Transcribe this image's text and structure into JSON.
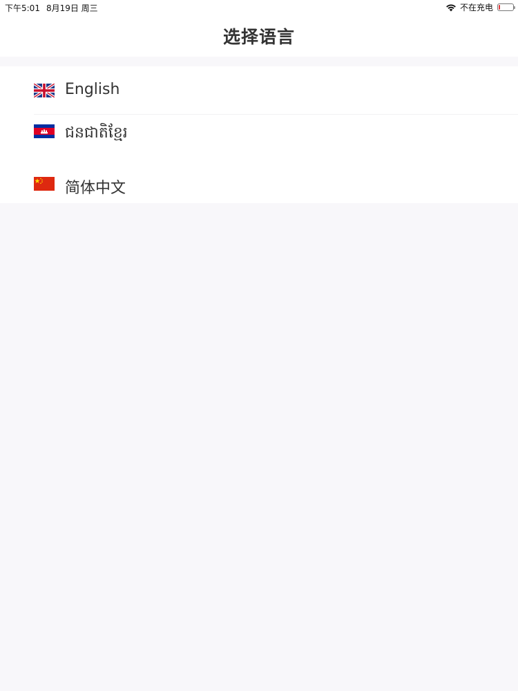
{
  "status_bar": {
    "time": "下午5:01",
    "date": "8月19日 周三",
    "charging_status": "不在充电",
    "wifi_icon": "wifi-icon",
    "battery_icon": "battery-icon",
    "battery_level": 0.08,
    "battery_color": "#e0373b"
  },
  "nav": {
    "title": "选择语言"
  },
  "languages": [
    {
      "label": "English",
      "flag": "uk-flag-icon"
    },
    {
      "label": "ជនជាតិខ្មែរ",
      "flag": "cambodia-flag-icon"
    },
    {
      "label": "简体中文",
      "flag": "china-flag-icon"
    }
  ],
  "colors": {
    "background": "#f8f7fa",
    "cell": "#ffffff",
    "text": "#333333"
  }
}
